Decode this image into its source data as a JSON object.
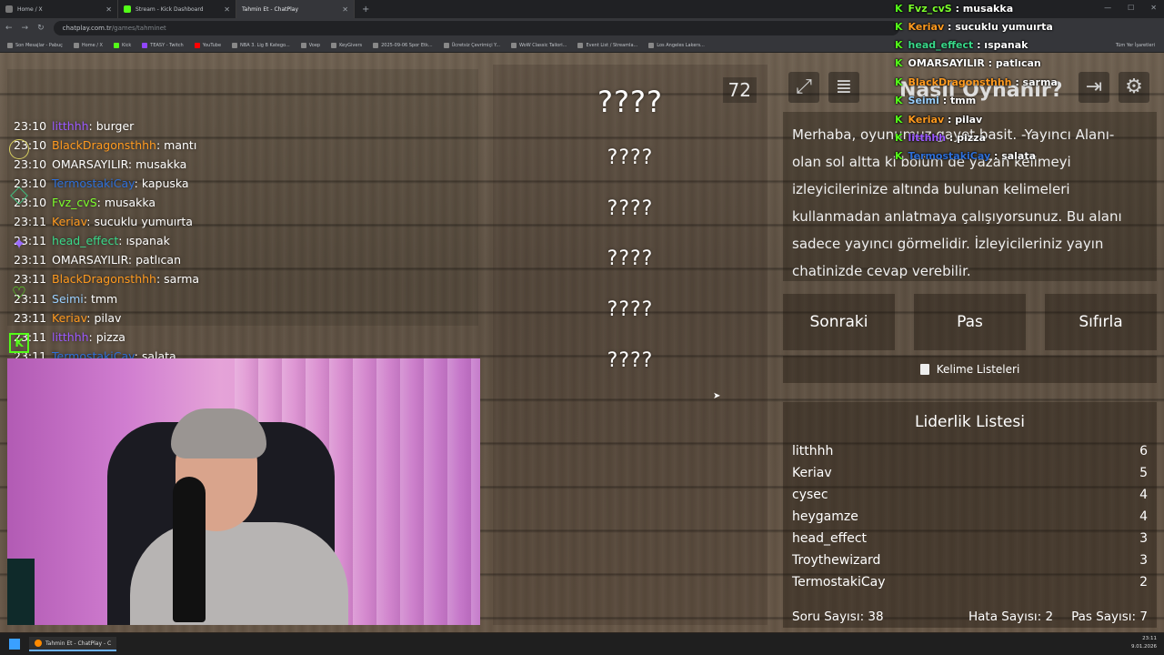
{
  "browser": {
    "tabs": [
      {
        "title": "Home / X",
        "active": false
      },
      {
        "title": "Stream - Kick Dashboard",
        "active": false
      },
      {
        "title": "Tahmin Et - ChatPlay",
        "active": true
      }
    ],
    "url_host": "chatplay.com.tr",
    "url_path": "/games/tahminet",
    "bookmarks": [
      "Son Mesajlar - Pabuç",
      "Home / X",
      "Kick",
      "TEASY - Twitch",
      "YouTube",
      "NBA 3. Lig B Katego...",
      "Voep",
      "KeyGivers",
      "2025-09-06 Spor Etk...",
      "Ücretsiz Çevrimiçi Y...",
      "WoW Classic Tailori...",
      "Event List / Streamla...",
      "Los Angeles Lakers..."
    ],
    "other_bookmarks": "Tüm Yer İşaretleri"
  },
  "chat": [
    {
      "time": "23:10",
      "user": "litthhh",
      "color": "#9b59ff",
      "msg": "burger"
    },
    {
      "time": "23:10",
      "user": "BlackDragonsthhh",
      "color": "#ff9a1f",
      "msg": "mantı"
    },
    {
      "time": "23:10",
      "user": "OMARSAYILIR",
      "color": "#ffffff",
      "msg": "musakka"
    },
    {
      "time": "23:10",
      "user": "TermostakiCay",
      "color": "#2e6fd8",
      "msg": "kapuska"
    },
    {
      "time": "23:10",
      "user": "Fvz_cvS",
      "color": "#7cff2c",
      "msg": "musakka"
    },
    {
      "time": "23:11",
      "user": "Keriav",
      "color": "#ff9a1f",
      "msg": "sucuklu yumuırta"
    },
    {
      "time": "23:11",
      "user": "head_effect",
      "color": "#39d98a",
      "msg": "ıspanak"
    },
    {
      "time": "23:11",
      "user": "OMARSAYILIR",
      "color": "#ffffff",
      "msg": "patlıcan"
    },
    {
      "time": "23:11",
      "user": "BlackDragonsthhh",
      "color": "#ff9a1f",
      "msg": "sarma"
    },
    {
      "time": "23:11",
      "user": "Seimi",
      "color": "#9ad0ff",
      "msg": "tmm"
    },
    {
      "time": "23:11",
      "user": "Keriav",
      "color": "#ff9a1f",
      "msg": "pilav"
    },
    {
      "time": "23:11",
      "user": "litthhh",
      "color": "#9b59ff",
      "msg": "pizza"
    },
    {
      "time": "23:11",
      "user": "TermostakiCay",
      "color": "#2e6fd8",
      "msg": "salata"
    }
  ],
  "game": {
    "timer": "72",
    "words": [
      "????",
      "????",
      "????",
      "????",
      "????",
      "????"
    ],
    "how_title": "Nasıl Oynanır?",
    "rules": "Merhaba, oyunumuz gayet basit. -Yayıncı Alanı- olan sol altta ki bölüm de yazan kelimeyi izleyicilerinize altında bulunan kelimeleri kullanmadan anlatmaya çalışıyorsunuz. Bu alanı sadece yayıncı görmelidir. İzleyicileriniz yayın chatinizde cevap verebilir.",
    "buttons": {
      "next": "Sonraki",
      "pass": "Pas",
      "reset": "Sıfırla"
    },
    "word_lists": "Kelime Listeleri",
    "leaderboard_title": "Liderlik Listesi",
    "leaderboard": [
      {
        "name": "litthhh",
        "score": "6"
      },
      {
        "name": "Keriav",
        "score": "5"
      },
      {
        "name": "cysec",
        "score": "4"
      },
      {
        "name": "heygamze",
        "score": "4"
      },
      {
        "name": "head_effect",
        "score": "3"
      },
      {
        "name": "Troythewizard",
        "score": "3"
      },
      {
        "name": "TermostakiCay",
        "score": "2"
      }
    ],
    "stats": {
      "questions": "Soru Sayısı: 38",
      "errors": "Hata Sayısı: 2",
      "passes": "Pas Sayısı: 7"
    }
  },
  "overlay_chat": [
    {
      "user": "Fvz_cvS",
      "color": "#7cff2c",
      "msg": "musakka"
    },
    {
      "user": "Keriav",
      "color": "#ff9a1f",
      "msg": "sucuklu yumuırta"
    },
    {
      "user": "head_effect",
      "color": "#39d98a",
      "msg": "ıspanak"
    },
    {
      "user": "OMARSAYILIR",
      "color": "#ffffff",
      "msg": "patlıcan"
    },
    {
      "user": "BlackDragonsthhh",
      "color": "#ff9a1f",
      "msg": "sarma"
    },
    {
      "user": "Seimi",
      "color": "#9ad0ff",
      "msg": "tmm"
    },
    {
      "user": "Keriav",
      "color": "#ff9a1f",
      "msg": "pilav"
    },
    {
      "user": "litthhh",
      "color": "#9b59ff",
      "msg": "pizza"
    },
    {
      "user": "TermostakiCay",
      "color": "#2e6fd8",
      "msg": "salata"
    }
  ],
  "taskbar": {
    "app": "Tahmin Et - ChatPlay - C",
    "time": "23:11",
    "date": "9.01.2026"
  }
}
